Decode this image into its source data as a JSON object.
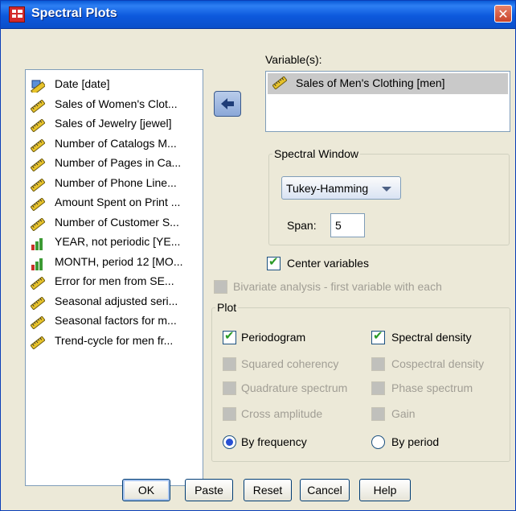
{
  "window": {
    "title": "Spectral Plots"
  },
  "source_list": {
    "items": [
      {
        "label": "Date [date]",
        "icon": "date-ruler-icon"
      },
      {
        "label": "Sales of Women's Clot...",
        "icon": "scale-ruler-icon"
      },
      {
        "label": "Sales of Jewelry [jewel]",
        "icon": "scale-ruler-icon"
      },
      {
        "label": "Number of Catalogs M...",
        "icon": "scale-ruler-icon"
      },
      {
        "label": "Number of Pages in Ca...",
        "icon": "scale-ruler-icon"
      },
      {
        "label": "Number of Phone Line...",
        "icon": "scale-ruler-icon"
      },
      {
        "label": "Amount Spent on Print ...",
        "icon": "scale-ruler-icon"
      },
      {
        "label": "Number of Customer S...",
        "icon": "scale-ruler-icon"
      },
      {
        "label": "YEAR, not periodic [YE...",
        "icon": "ordinal-bars-icon"
      },
      {
        "label": "MONTH, period 12 [MO...",
        "icon": "ordinal-bars-icon"
      },
      {
        "label": "Error for men from SE...",
        "icon": "scale-ruler-icon"
      },
      {
        "label": "Seasonal adjusted seri...",
        "icon": "scale-ruler-icon"
      },
      {
        "label": "Seasonal factors for m...",
        "icon": "scale-ruler-icon"
      },
      {
        "label": "Trend-cycle for men fr...",
        "icon": "scale-ruler-icon"
      }
    ]
  },
  "variables": {
    "label": "Variable(s):",
    "items": [
      {
        "label": "Sales of Men's Clothing [men]",
        "icon": "scale-ruler-icon"
      }
    ]
  },
  "spectral_window": {
    "legend": "Spectral Window",
    "type_value": "Tukey-Hamming",
    "span_label": "Span:",
    "span_value": "5"
  },
  "center_variables": {
    "label": "Center variables",
    "checked": true
  },
  "bivariate": {
    "label": "Bivariate analysis - first variable with each",
    "checked": false,
    "enabled": false
  },
  "plot": {
    "legend": "Plot",
    "periodogram": {
      "label": "Periodogram",
      "checked": true
    },
    "spectral_density": {
      "label": "Spectral density",
      "checked": true
    },
    "squared_coherency": {
      "label": "Squared coherency",
      "enabled": false
    },
    "cospectral_density": {
      "label": "Cospectral density",
      "enabled": false
    },
    "quadrature_spectrum": {
      "label": "Quadrature spectrum",
      "enabled": false
    },
    "phase_spectrum": {
      "label": "Phase spectrum",
      "enabled": false
    },
    "cross_amplitude": {
      "label": "Cross amplitude",
      "enabled": false
    },
    "gain": {
      "label": "Gain",
      "enabled": false
    },
    "by_frequency": {
      "label": "By frequency",
      "selected": true
    },
    "by_period": {
      "label": "By period",
      "selected": false
    }
  },
  "buttons": {
    "ok": "OK",
    "paste": "Paste",
    "reset": "Reset",
    "cancel": "Cancel",
    "help": "Help"
  },
  "colors": {
    "titlebar": "#0a5ad6",
    "dialog_bg": "#ece9d8",
    "selection": "#c9c9c9",
    "check": "#2b9a26",
    "radio": "#2850d4"
  }
}
